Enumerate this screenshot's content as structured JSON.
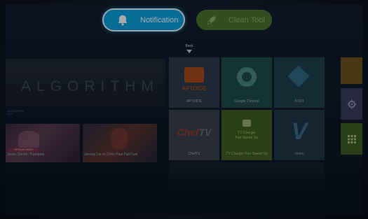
{
  "top_bar": {
    "notification_label": "Notification",
    "clean_tool_label": "Clean Tool"
  },
  "back_label": "Back",
  "banner": {
    "title": "ALGORITHM",
    "caption": "ALGORITHM",
    "subcaption": "2016"
  },
  "videos": [
    {
      "caption": "Jason Derulo: Trumpets",
      "overlay": "OFFICIAL MUSIC"
    },
    {
      "caption": "Jeremy Lin vs Chris Paul Full Duel"
    }
  ],
  "apps": {
    "aptoide": {
      "logo_text": "APTOIDE",
      "name": "APTOIDE"
    },
    "google": {
      "name": "Google Chrome"
    },
    "kodi": {
      "name": "KODI"
    },
    "chef": {
      "logo_a": "Chef",
      "logo_b": "TV",
      "name": "ChefTV"
    },
    "tv": {
      "line1": "TV Charger",
      "line2": "Fan Speed Up",
      "name": "TV Charger Fan Speed Up"
    },
    "vimeo": {
      "logo": "V",
      "name": "vimeo"
    }
  },
  "colors": {
    "notification_bg": "#0aa3dd",
    "clean_tool_bg": "#4f7b2c"
  }
}
